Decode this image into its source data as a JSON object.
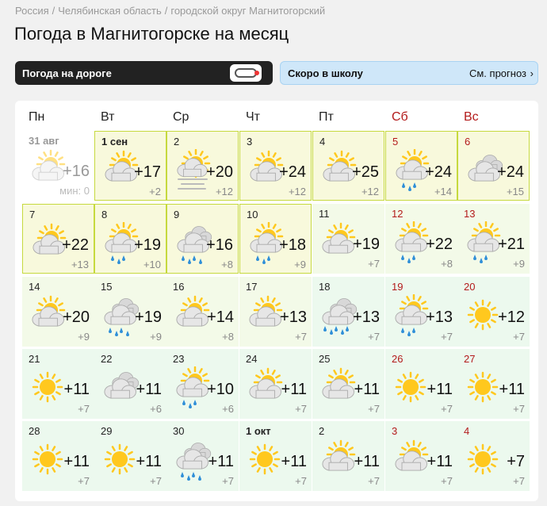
{
  "breadcrumbs": [
    "Россия",
    "Челябинская область",
    "городской округ Магнитогорский"
  ],
  "breadcrumb_separator": "/",
  "title": "Погода в Магнитогорске на месяц",
  "banners": {
    "road": {
      "label": "Погода на дороге",
      "icon": "car-icon"
    },
    "school": {
      "label": "Скоро в школу",
      "link": "См. прогноз",
      "arrow": "›"
    }
  },
  "weekdays": [
    {
      "label": "Пн",
      "weekend": false
    },
    {
      "label": "Вт",
      "weekend": false
    },
    {
      "label": "Ср",
      "weekend": false
    },
    {
      "label": "Чт",
      "weekend": false
    },
    {
      "label": "Пт",
      "weekend": false
    },
    {
      "label": "Сб",
      "weekend": true
    },
    {
      "label": "Вс",
      "weekend": true
    }
  ],
  "days": [
    {
      "date": "31 авг",
      "hi": "+16",
      "lo": "мин: 0",
      "icon": "cloudy-sun",
      "past": true
    },
    {
      "date": "1 сен",
      "hi": "+17",
      "lo": "+2",
      "icon": "cloudy-sun",
      "bold": true
    },
    {
      "date": "2",
      "hi": "+20",
      "lo": "+12",
      "icon": "fog-sun"
    },
    {
      "date": "3",
      "hi": "+24",
      "lo": "+12",
      "icon": "cloudy-sun"
    },
    {
      "date": "4",
      "hi": "+25",
      "lo": "+12",
      "icon": "cloudy-sun"
    },
    {
      "date": "5",
      "hi": "+24",
      "lo": "+14",
      "icon": "rain-sun",
      "weekend": true
    },
    {
      "date": "6",
      "hi": "+24",
      "lo": "+15",
      "icon": "cloudy",
      "weekend": true
    },
    {
      "date": "7",
      "hi": "+22",
      "lo": "+13",
      "icon": "cloudy-sun"
    },
    {
      "date": "8",
      "hi": "+19",
      "lo": "+10",
      "icon": "rain-sun"
    },
    {
      "date": "9",
      "hi": "+16",
      "lo": "+8",
      "icon": "rain"
    },
    {
      "date": "10",
      "hi": "+18",
      "lo": "+9",
      "icon": "rain-sun"
    },
    {
      "date": "11",
      "hi": "+19",
      "lo": "+7",
      "icon": "cloudy-sun"
    },
    {
      "date": "12",
      "hi": "+22",
      "lo": "+8",
      "icon": "rain-sun",
      "weekend": true
    },
    {
      "date": "13",
      "hi": "+21",
      "lo": "+9",
      "icon": "rain-sun",
      "weekend": true
    },
    {
      "date": "14",
      "hi": "+20",
      "lo": "+9",
      "icon": "cloudy-sun"
    },
    {
      "date": "15",
      "hi": "+19",
      "lo": "+9",
      "icon": "rain"
    },
    {
      "date": "16",
      "hi": "+14",
      "lo": "+8",
      "icon": "cloudy-sun"
    },
    {
      "date": "17",
      "hi": "+13",
      "lo": "+7",
      "icon": "cloudy-sun"
    },
    {
      "date": "18",
      "hi": "+13",
      "lo": "+7",
      "icon": "heavy-rain"
    },
    {
      "date": "19",
      "hi": "+13",
      "lo": "+7",
      "icon": "rain-sun",
      "weekend": true
    },
    {
      "date": "20",
      "hi": "+12",
      "lo": "+7",
      "icon": "sun",
      "weekend": true
    },
    {
      "date": "21",
      "hi": "+11",
      "lo": "+7",
      "icon": "sun"
    },
    {
      "date": "22",
      "hi": "+11",
      "lo": "+6",
      "icon": "cloudy"
    },
    {
      "date": "23",
      "hi": "+10",
      "lo": "+6",
      "icon": "rain-sun"
    },
    {
      "date": "24",
      "hi": "+11",
      "lo": "+7",
      "icon": "cloudy-sun"
    },
    {
      "date": "25",
      "hi": "+11",
      "lo": "+7",
      "icon": "cloudy-sun"
    },
    {
      "date": "26",
      "hi": "+11",
      "lo": "+7",
      "icon": "sun",
      "weekend": true
    },
    {
      "date": "27",
      "hi": "+11",
      "lo": "+7",
      "icon": "sun",
      "weekend": true
    },
    {
      "date": "28",
      "hi": "+11",
      "lo": "+7",
      "icon": "sun"
    },
    {
      "date": "29",
      "hi": "+11",
      "lo": "+7",
      "icon": "sun"
    },
    {
      "date": "30",
      "hi": "+11",
      "lo": "+7",
      "icon": "rain"
    },
    {
      "date": "1 окт",
      "hi": "+11",
      "lo": "+7",
      "icon": "sun",
      "bold": true
    },
    {
      "date": "2",
      "hi": "+11",
      "lo": "+7",
      "icon": "cloudy-sun"
    },
    {
      "date": "3",
      "hi": "+11",
      "lo": "+7",
      "icon": "cloudy-sun",
      "weekend": true
    },
    {
      "date": "4",
      "hi": "+7",
      "lo": "+7",
      "icon": "sun",
      "weekend": true
    }
  ],
  "colors": {
    "weekend_text": "#b31b1b",
    "near_bg": "#f8f9dc",
    "near_border": "#c6d93e",
    "far_bg": "#ecf9ee",
    "sun": "#ffc81e",
    "cloud": "#c7c7c7",
    "rain": "#2f8fd8"
  }
}
